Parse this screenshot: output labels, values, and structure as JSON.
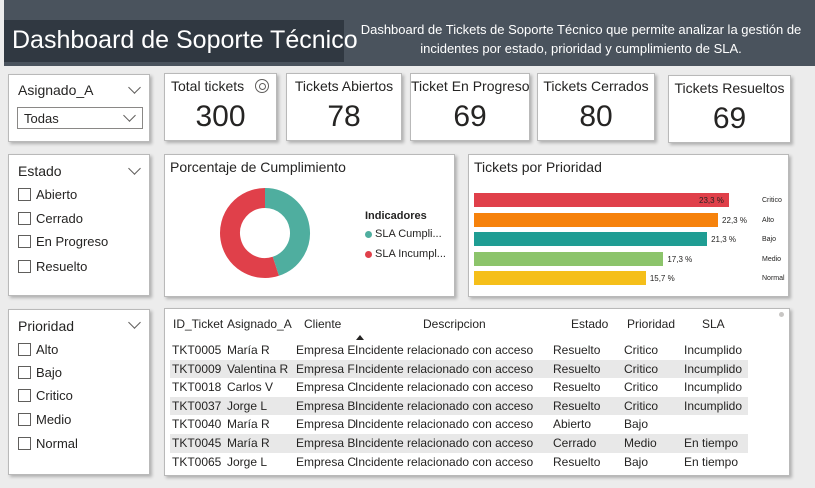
{
  "header": {
    "title": "Dashboard de Soporte Técnico",
    "description": "Dashboard de Tickets de Soporte Técnico que permite analizar la gestión de incidentes por estado, prioridad y cumplimiento de SLA."
  },
  "slicers": {
    "asignado": {
      "title": "Asignado_A",
      "selected": "Todas"
    },
    "estado": {
      "title": "Estado",
      "options": [
        "Abierto",
        "Cerrado",
        "En Progreso",
        "Resuelto"
      ]
    },
    "prioridad": {
      "title": "Prioridad",
      "options": [
        "Alto",
        "Bajo",
        "Critico",
        "Medio",
        "Normal"
      ]
    }
  },
  "kpis": {
    "total": {
      "label": "Total tickets",
      "value": "300"
    },
    "abiertos": {
      "label": "Tickets Abiertos",
      "value": "78"
    },
    "progreso": {
      "label": "Ticket En Progreso",
      "value": "69"
    },
    "cerrados": {
      "label": "Tickets Cerrados",
      "value": "80"
    },
    "resueltos": {
      "label": "Tickets Resueltos",
      "value": "69"
    }
  },
  "donut": {
    "title": "Porcentaje de Cumplimiento",
    "legend_title": "Indicadores",
    "legend": [
      {
        "label": "SLA Cumpli...",
        "color": "#4fae9f"
      },
      {
        "label": "SLA Incumpl...",
        "color": "#e0404a"
      }
    ]
  },
  "bars": {
    "title": "Tickets por Prioridad"
  },
  "chart_data": [
    {
      "type": "pie",
      "title": "Porcentaje de Cumplimiento",
      "legend_title": "Indicadores",
      "categories": [
        "SLA Cumpli...",
        "SLA Incumpl..."
      ],
      "values": [
        45,
        55
      ],
      "colors": [
        "#4fae9f",
        "#e0404a"
      ]
    },
    {
      "type": "bar",
      "orientation": "horizontal",
      "title": "Tickets por Prioridad",
      "categories": [
        "Critico",
        "Alto",
        "Bajo",
        "Medio",
        "Normal"
      ],
      "values": [
        23.3,
        22.3,
        21.3,
        17.3,
        15.7
      ],
      "value_labels": [
        "23,3 %",
        "22,3 %",
        "21,3 %",
        "17,3 %",
        "15,7 %"
      ],
      "colors": [
        "#e0404a",
        "#f6820c",
        "#1f9d93",
        "#8cc46b",
        "#f5bf1a"
      ],
      "xlim": [
        0,
        23.3
      ]
    }
  ],
  "table": {
    "columns": [
      "ID_Ticket",
      "Asignado_A",
      "Cliente",
      "Descripcion",
      "Estado",
      "Prioridad",
      "SLA"
    ],
    "rows": [
      [
        "TKT0005",
        "María R",
        "Empresa E",
        "Incidente relacionado con acceso",
        "Resuelto",
        "Critico",
        "Incumplido"
      ],
      [
        "TKT0009",
        "Valentina R",
        "Empresa F",
        "Incidente relacionado con acceso",
        "Resuelto",
        "Critico",
        "Incumplido"
      ],
      [
        "TKT0018",
        "Carlos V",
        "Empresa C",
        "Incidente relacionado con acceso",
        "Resuelto",
        "Critico",
        "Incumplido"
      ],
      [
        "TKT0037",
        "Jorge L",
        "Empresa B",
        "Incidente relacionado con acceso",
        "Resuelto",
        "Critico",
        "Incumplido"
      ],
      [
        "TKT0040",
        "María R",
        "Empresa D",
        "Incidente relacionado con acceso",
        "Abierto",
        "Bajo",
        ""
      ],
      [
        "TKT0045",
        "María R",
        "Empresa B",
        "Incidente relacionado con acceso",
        "Cerrado",
        "Medio",
        "En tiempo"
      ],
      [
        "TKT0065",
        "Jorge L",
        "Empresa C",
        "Incidente relacionado con acceso",
        "Resuelto",
        "Bajo",
        "En tiempo"
      ]
    ]
  }
}
